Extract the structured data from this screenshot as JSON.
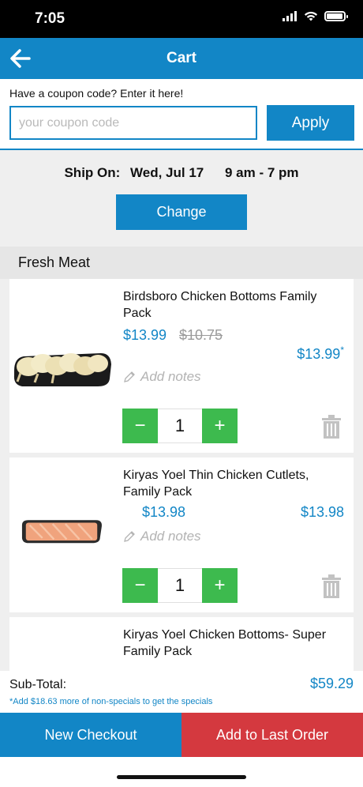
{
  "status_bar": {
    "time": "7:05"
  },
  "nav": {
    "title": "Cart"
  },
  "coupon": {
    "label": "Have a coupon code? Enter it here!",
    "placeholder": "your coupon code",
    "apply_label": "Apply"
  },
  "shipping": {
    "label": "Ship On:",
    "date": "Wed, Jul 17",
    "window": "9 am - 7 pm",
    "change_label": "Change"
  },
  "section": {
    "title": "Fresh Meat"
  },
  "items": [
    {
      "name": "Birdsboro Chicken Bottoms Family Pack",
      "price": "$13.99",
      "original_price": "$10.75",
      "total": "$13.99",
      "total_mark": "*",
      "notes_placeholder": "Add notes",
      "quantity": "1"
    },
    {
      "name": "Kiryas Yoel Thin Chicken Cutlets, Family Pack",
      "price": "$13.98",
      "total": "$13.98",
      "notes_placeholder": "Add notes",
      "quantity": "1"
    },
    {
      "name": "Kiryas Yoel Chicken Bottoms- Super Family Pack"
    }
  ],
  "summary": {
    "subtotal_label": "Sub-Total:",
    "subtotal_value": "$59.29",
    "note": "*Add $18.63 more of non-specials to get the specials"
  },
  "actions": {
    "new_checkout": "New Checkout",
    "add_to_last_order": "Add to Last Order"
  },
  "icons": {
    "back": "arrow-left-icon",
    "signal": "signal-icon",
    "wifi": "wifi-icon",
    "battery": "battery-icon",
    "pencil": "pencil-icon",
    "trash": "trash-icon",
    "minus": "minus-icon",
    "plus": "plus-icon"
  },
  "colors": {
    "primary": "#1286c6",
    "green": "#3dba4e",
    "red": "#d4393f",
    "background": "#efefef"
  }
}
